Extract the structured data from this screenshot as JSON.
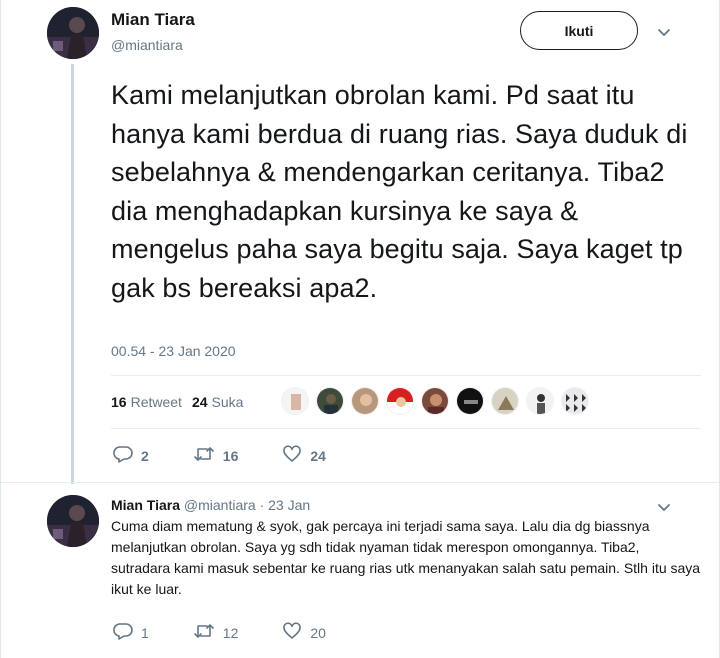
{
  "tweet": {
    "author_name": "Mian Tiara",
    "author_handle": "@miantiara",
    "follow_label": "Ikuti",
    "text": "Kami melanjutkan obrolan kami. Pd saat itu hanya kami berdua di ruang rias. Saya duduk di sebelahnya & mendengarkan ceritanya. Tiba2 dia menghadapkan kursinya ke saya & mengelus paha saya begitu saja. Saya kaget tp gak bs bereaksi apa2.",
    "timestamp": "00.54 - 23 Jan 2020",
    "retweet_count": "16",
    "retweet_label": "Retweet",
    "like_count": "24",
    "like_label": "Suka",
    "actions": {
      "reply_count": "2",
      "retweet_count": "16",
      "like_count": "24"
    }
  },
  "reply": {
    "author_name": "Mian Tiara",
    "author_handle": "@miantiara",
    "date": "· 23 Jan",
    "text": "Cuma diam mematung & syok, gak percaya ini terjadi sama saya. Lalu dia dg biassnya melanjutkan obrolan. Saya yg sdh tidak nyaman tidak merespon omongannya. Tiba2, sutradara kami masuk sebentar ke ruang rias utk menanyakan salah satu pemain. Stlh itu saya ikut ke luar.",
    "actions": {
      "reply_count": "1",
      "retweet_count": "12",
      "like_count": "20"
    }
  },
  "colors": {
    "text_primary": "#14171a",
    "text_secondary": "#657786",
    "divider": "#e6ecf0",
    "thread_line": "#ccd6dd"
  },
  "icons": [
    "reply-icon",
    "retweet-icon",
    "heart-icon",
    "chevron-down-icon"
  ]
}
